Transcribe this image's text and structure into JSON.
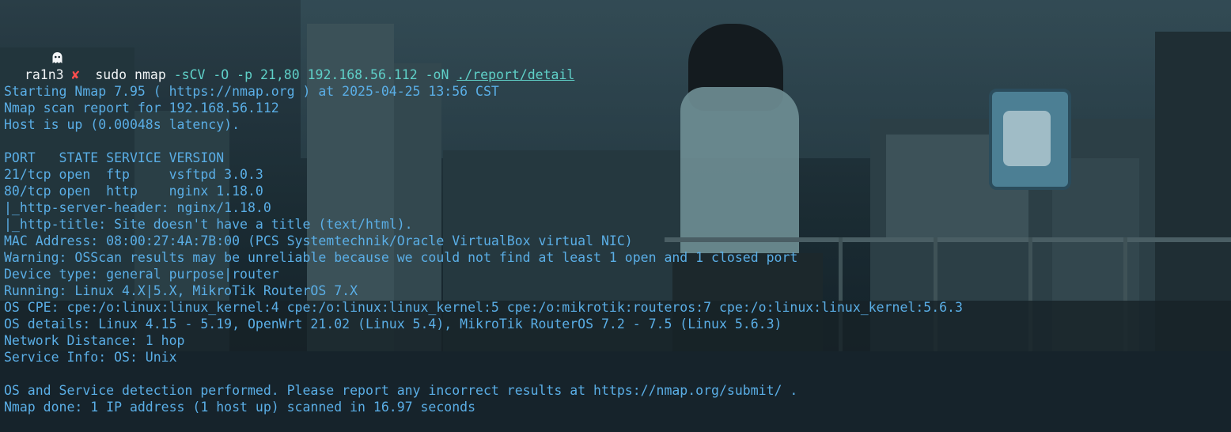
{
  "prompt": {
    "icon": "ghost-icon",
    "user": "ra1n3",
    "status_icon": "cross-icon",
    "status_symbol": "✘",
    "command": "sudo nmap",
    "args": "-sCV -O -p 21,80 192.168.56.112 -oN",
    "output_path": "./report/detail"
  },
  "output_lines": [
    "Starting Nmap 7.95 ( https://nmap.org ) at 2025-04-25 13:56 CST",
    "Nmap scan report for 192.168.56.112",
    "Host is up (0.00048s latency).",
    "",
    "PORT   STATE SERVICE VERSION",
    "21/tcp open  ftp     vsftpd 3.0.3",
    "80/tcp open  http    nginx 1.18.0",
    "|_http-server-header: nginx/1.18.0",
    "|_http-title: Site doesn't have a title (text/html).",
    "MAC Address: 08:00:27:4A:7B:00 (PCS Systemtechnik/Oracle VirtualBox virtual NIC)",
    "Warning: OSScan results may be unreliable because we could not find at least 1 open and 1 closed port",
    "Device type: general purpose|router",
    "Running: Linux 4.X|5.X, MikroTik RouterOS 7.X",
    "OS CPE: cpe:/o:linux:linux_kernel:4 cpe:/o:linux:linux_kernel:5 cpe:/o:mikrotik:routeros:7 cpe:/o:linux:linux_kernel:5.6.3",
    "OS details: Linux 4.15 - 5.19, OpenWrt 21.02 (Linux 5.4), MikroTik RouterOS 7.2 - 7.5 (Linux 5.6.3)",
    "Network Distance: 1 hop",
    "Service Info: OS: Unix",
    "",
    "OS and Service detection performed. Please report any incorrect results at https://nmap.org/submit/ .",
    "Nmap done: 1 IP address (1 host up) scanned in 16.97 seconds"
  ],
  "colors": {
    "output_text": "#5aaee6",
    "prompt_text": "#f0f3f5",
    "args_text": "#5fd0c8",
    "error_mark": "#ff4d4d"
  }
}
